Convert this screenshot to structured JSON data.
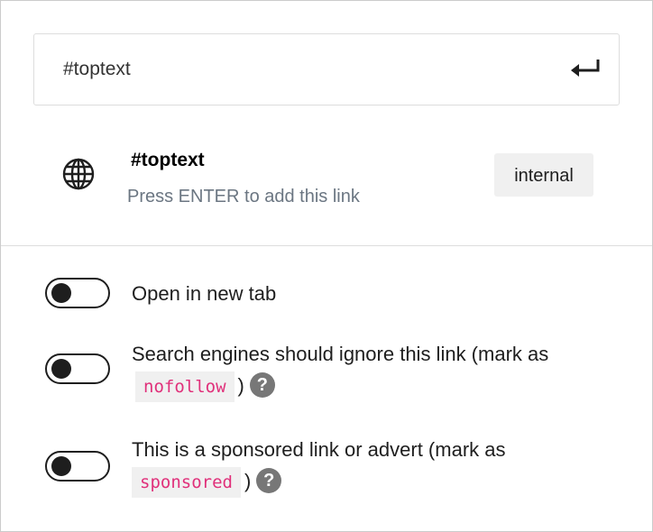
{
  "search": {
    "value": "#toptext",
    "submit_icon": "enter-icon"
  },
  "suggestion": {
    "icon": "globe-icon",
    "title": "#toptext",
    "subtitle": "Press ENTER to add this link",
    "badge": "internal"
  },
  "options": [
    {
      "label": "Open in new tab",
      "enabled": false
    },
    {
      "label_before": "Search engines should ignore this link (mark as",
      "code": "nofollow",
      "label_after": ")",
      "help": "?",
      "enabled": false
    },
    {
      "label_before": "This is a sponsored link or advert (mark as",
      "code": "sponsored",
      "label_after": ")",
      "help": "?",
      "enabled": false
    }
  ],
  "colors": {
    "code_text": "#e0307a",
    "code_bg": "#f0f0f0",
    "subtitle": "#6b7682"
  }
}
